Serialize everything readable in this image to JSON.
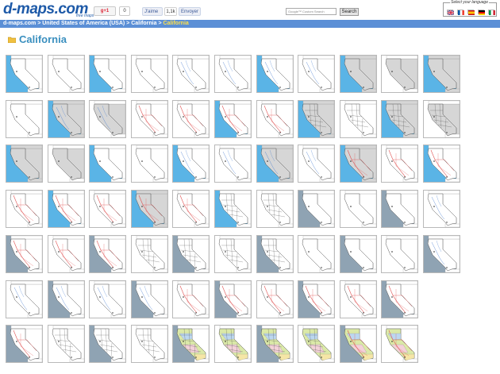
{
  "header": {
    "logo_text": "d-maps.com",
    "logo_sub": "free maps",
    "gplus_label": "g+1",
    "gplus_count": "0",
    "fb_like_label": "J'aime",
    "fb_like_count": "1,1k",
    "fb_send_label": "Envoyer",
    "search_placeholder": "Google™ Custom Search",
    "search_button": "Search",
    "language_label": "Select your language",
    "flags": [
      "flag-uk",
      "flag-fr",
      "flag-es",
      "flag-de",
      "flag-it"
    ]
  },
  "breadcrumb": {
    "items": [
      "d-maps.com",
      "United States of America (USA)",
      "California"
    ],
    "current": "California",
    "separator": ">"
  },
  "page_title": "California",
  "colors": {
    "ocean_blue": "#5ab4e6",
    "slate": "#8fa3b3",
    "land_grey": "#d6d6d6",
    "road_red": "#e05050",
    "breadcrumb_bar": "#5b8fd6",
    "title": "#3a8fbf"
  },
  "thumbnails": [
    [
      {
        "s": "blue",
        "l": "white",
        "d": ""
      },
      {
        "s": "white",
        "l": "white",
        "d": ""
      },
      {
        "s": "blue",
        "l": "white",
        "d": ""
      },
      {
        "s": "white",
        "l": "white",
        "d": ""
      },
      {
        "s": "white",
        "l": "white",
        "d": "rivers"
      },
      {
        "s": "white",
        "l": "white",
        "d": "rivers"
      },
      {
        "s": "blue",
        "l": "white",
        "d": "rivers"
      },
      {
        "s": "white",
        "l": "white",
        "d": "rivers"
      },
      {
        "s": "blue",
        "l": "grey",
        "d": ""
      },
      {
        "s": "white",
        "l": "grey",
        "d": ""
      },
      {
        "s": "blue",
        "l": "grey",
        "d": ""
      }
    ],
    [
      {
        "s": "white",
        "l": "white",
        "d": ""
      },
      {
        "s": "blue",
        "l": "grey",
        "d": "rivers"
      },
      {
        "s": "white",
        "l": "grey",
        "d": "rivers"
      },
      {
        "s": "white",
        "l": "white",
        "d": "roads"
      },
      {
        "s": "white",
        "l": "white",
        "d": "roads"
      },
      {
        "s": "blue",
        "l": "white",
        "d": "roads"
      },
      {
        "s": "white",
        "l": "white",
        "d": "roads"
      },
      {
        "s": "blue",
        "l": "grey",
        "d": "counties"
      },
      {
        "s": "white",
        "l": "white",
        "d": "counties"
      },
      {
        "s": "blue",
        "l": "grey",
        "d": "counties"
      },
      {
        "s": "white",
        "l": "grey",
        "d": "counties"
      }
    ],
    [
      {
        "s": "blue",
        "l": "grey",
        "d": ""
      },
      {
        "s": "white",
        "l": "grey",
        "d": ""
      },
      {
        "s": "blue",
        "l": "white",
        "d": ""
      },
      {
        "s": "white",
        "l": "white",
        "d": ""
      },
      {
        "s": "blue",
        "l": "white",
        "d": "rivers"
      },
      {
        "s": "white",
        "l": "white",
        "d": "rivers"
      },
      {
        "s": "blue",
        "l": "grey",
        "d": "rivers"
      },
      {
        "s": "white",
        "l": "white",
        "d": "rivers"
      },
      {
        "s": "blue",
        "l": "grey",
        "d": "roads"
      },
      {
        "s": "white",
        "l": "white",
        "d": "roads"
      },
      {
        "s": "blue",
        "l": "white",
        "d": "roads"
      }
    ],
    [
      {
        "s": "white",
        "l": "white",
        "d": "roads"
      },
      {
        "s": "blue",
        "l": "white",
        "d": "roads"
      },
      {
        "s": "white",
        "l": "white",
        "d": "roads"
      },
      {
        "s": "blue",
        "l": "grey",
        "d": "roads"
      },
      {
        "s": "white",
        "l": "white",
        "d": "roads"
      },
      {
        "s": "blue",
        "l": "white",
        "d": "counties"
      },
      {
        "s": "white",
        "l": "white",
        "d": "counties"
      },
      {
        "s": "slate",
        "l": "white",
        "d": ""
      },
      {
        "s": "white",
        "l": "white",
        "d": ""
      },
      {
        "s": "slate",
        "l": "white",
        "d": ""
      },
      {
        "s": "white",
        "l": "white",
        "d": "rivers"
      }
    ],
    [
      {
        "s": "slate",
        "l": "white",
        "d": "roads"
      },
      {
        "s": "white",
        "l": "white",
        "d": "roads"
      },
      {
        "s": "slate",
        "l": "white",
        "d": "roads"
      },
      {
        "s": "white",
        "l": "white",
        "d": "counties"
      },
      {
        "s": "slate",
        "l": "white",
        "d": "counties"
      },
      {
        "s": "white",
        "l": "white",
        "d": "counties"
      },
      {
        "s": "slate",
        "l": "white",
        "d": "counties"
      },
      {
        "s": "white",
        "l": "white",
        "d": ""
      },
      {
        "s": "slate",
        "l": "white",
        "d": ""
      },
      {
        "s": "white",
        "l": "white",
        "d": ""
      },
      {
        "s": "slate",
        "l": "white",
        "d": "rivers"
      }
    ],
    [
      {
        "s": "white",
        "l": "white",
        "d": "rivers"
      },
      {
        "s": "slate",
        "l": "white",
        "d": "rivers"
      },
      {
        "s": "white",
        "l": "white",
        "d": "rivers"
      },
      {
        "s": "slate",
        "l": "white",
        "d": "rivers"
      },
      {
        "s": "white",
        "l": "white",
        "d": "roads"
      },
      {
        "s": "slate",
        "l": "white",
        "d": "roads"
      },
      {
        "s": "white",
        "l": "white",
        "d": "roads"
      },
      {
        "s": "slate",
        "l": "white",
        "d": "roads"
      },
      {
        "s": "white",
        "l": "white",
        "d": "roads"
      },
      {
        "s": "slate",
        "l": "white",
        "d": "roads"
      }
    ],
    [
      {
        "s": "slate",
        "l": "white",
        "d": "roads"
      },
      {
        "s": "white",
        "l": "white",
        "d": "counties"
      },
      {
        "s": "slate",
        "l": "white",
        "d": "counties"
      },
      {
        "s": "white",
        "l": "white",
        "d": "counties"
      },
      {
        "s": "slate",
        "l": "color",
        "d": "counties"
      },
      {
        "s": "white",
        "l": "color",
        "d": "counties"
      },
      {
        "s": "slate",
        "l": "color",
        "d": "counties"
      },
      {
        "s": "white",
        "l": "color",
        "d": "counties"
      },
      {
        "s": "slate",
        "l": "color",
        "d": "roads"
      },
      {
        "s": "white",
        "l": "color",
        "d": "roads"
      }
    ]
  ]
}
